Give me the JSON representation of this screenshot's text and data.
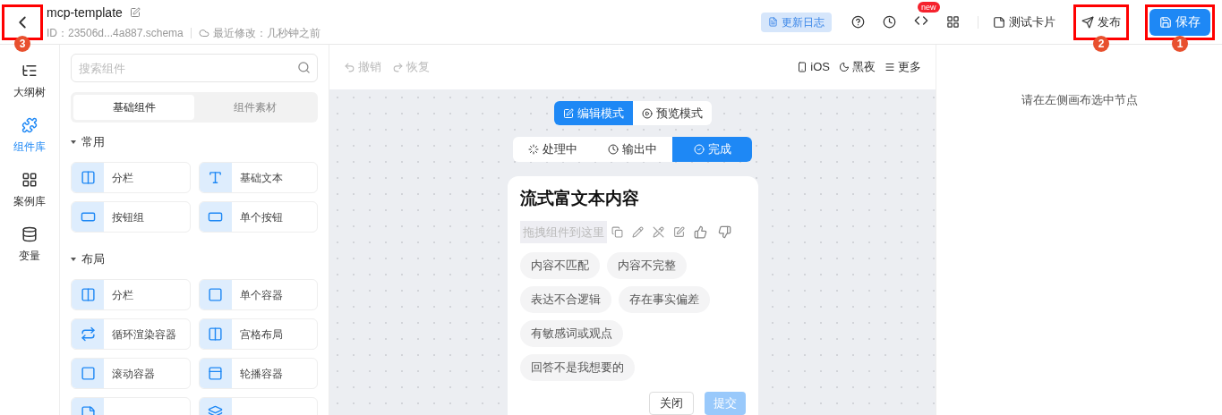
{
  "header": {
    "back": {
      "annotation": "3"
    },
    "title": "mcp-template",
    "id": "ID：23506d...4a887.schema",
    "modified": "最近修改：几秒钟之前",
    "changelog": "更新日志",
    "new_badge": "new",
    "test_card": "测试卡片",
    "publish": {
      "label": "发布",
      "annotation": "2"
    },
    "save": {
      "label": "保存",
      "annotation": "1"
    }
  },
  "rail": [
    {
      "label": "大纲树",
      "kind": "tree",
      "selected": false
    },
    {
      "label": "组件库",
      "kind": "puzzle",
      "selected": true
    },
    {
      "label": "案例库",
      "kind": "grid",
      "selected": false
    },
    {
      "label": "变量",
      "kind": "database",
      "selected": false
    }
  ],
  "panel": {
    "search_placeholder": "搜索组件",
    "tabs": [
      {
        "label": "基础组件",
        "selected": true
      },
      {
        "label": "组件素材",
        "selected": false
      }
    ],
    "sections": [
      {
        "title": "常用",
        "expanded": true,
        "items": [
          {
            "label": "分栏",
            "kind": "columns"
          },
          {
            "label": "基础文本",
            "kind": "text"
          },
          {
            "label": "按钮组",
            "kind": "btn"
          },
          {
            "label": "单个按钮",
            "kind": "btn"
          }
        ]
      },
      {
        "title": "布局",
        "expanded": true,
        "items": [
          {
            "label": "分栏",
            "kind": "columns"
          },
          {
            "label": "单个容器",
            "kind": "square"
          },
          {
            "label": "循环渲染容器",
            "kind": "loop"
          },
          {
            "label": "宫格布局",
            "kind": "columns"
          },
          {
            "label": "滚动容器",
            "kind": "square"
          },
          {
            "label": "轮播容器",
            "kind": "carousel"
          },
          {
            "kind": "frame"
          },
          {
            "kind": "stack"
          }
        ]
      }
    ]
  },
  "canvas": {
    "undo": "撤销",
    "redo": "恢复",
    "device": "iOS",
    "theme": "黑夜",
    "more": "更多",
    "modes": [
      {
        "label": "编辑模式",
        "kind": "edit",
        "selected": true
      },
      {
        "label": "预览模式",
        "kind": "play",
        "selected": false
      }
    ],
    "states": [
      {
        "label": "处理中",
        "kind": "loader",
        "selected": false
      },
      {
        "label": "输出中",
        "kind": "clock",
        "selected": false
      },
      {
        "label": "完成",
        "kind": "check",
        "selected": true
      }
    ],
    "card": {
      "title": "流式富文本内容",
      "drop_hint": "拖拽组件到这里",
      "tags": [
        "内容不匹配",
        "内容不完整",
        "表达不合逻辑",
        "存在事实偏差",
        "有敏感词或观点",
        "回答不是我想要的"
      ],
      "close": "关闭",
      "submit": {
        "label": "提交",
        "disabled": true
      }
    }
  },
  "right_panel": {
    "empty_text": "请在左侧画布选中节点"
  }
}
